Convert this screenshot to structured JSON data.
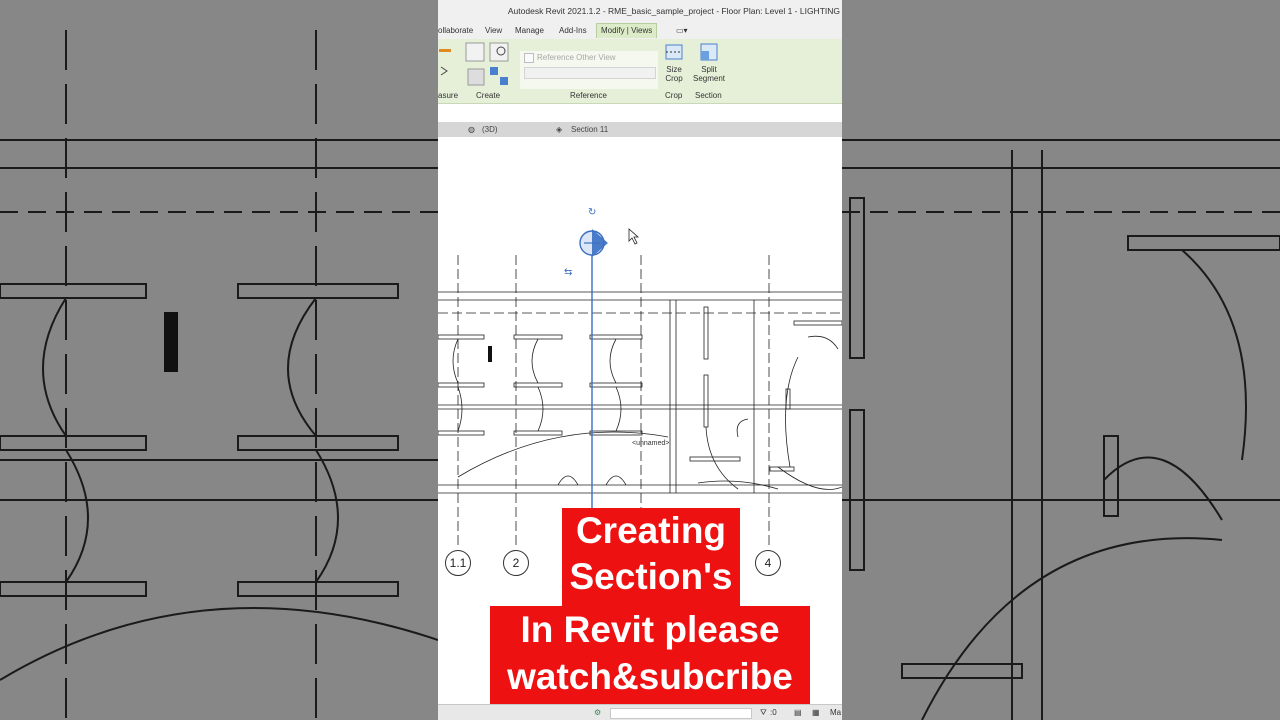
{
  "window": {
    "title": "Autodesk Revit 2021.1.2 - RME_basic_sample_project - Floor Plan: Level 1 - LIGHTING"
  },
  "tabs": [
    {
      "label": "ollaborate"
    },
    {
      "label": "View"
    },
    {
      "label": "Manage"
    },
    {
      "label": "Add-Ins"
    },
    {
      "label": "Modify | Views",
      "active": true
    }
  ],
  "ribbon": {
    "panels": {
      "measure": "asure",
      "create": "Create",
      "reference": "Reference",
      "crop": "Crop",
      "section": "Section"
    },
    "reference_other_view": "Reference Other View",
    "size_crop": "Size\nCrop",
    "size_crop_l1": "Size",
    "size_crop_l2": "Crop",
    "split_segment_l1": "Split",
    "split_segment_l2": "Segment"
  },
  "quickbar": {
    "view_3d": "(3D)",
    "section": "Section 11"
  },
  "canvas": {
    "grid_labels": [
      "1.1",
      "2",
      "4"
    ],
    "room_tag": "<unnamed>"
  },
  "statusbar": {
    "zero": ":0",
    "ma": "Ma"
  },
  "caption": {
    "line1": "Creating",
    "line2": "Section's",
    "line3": "In Revit please",
    "line4": "watch&subcribe"
  },
  "colors": {
    "ribbon_bg": "#e6f0d9",
    "section_line": "#3a6fc4",
    "caption_bg": "#ee1111"
  }
}
